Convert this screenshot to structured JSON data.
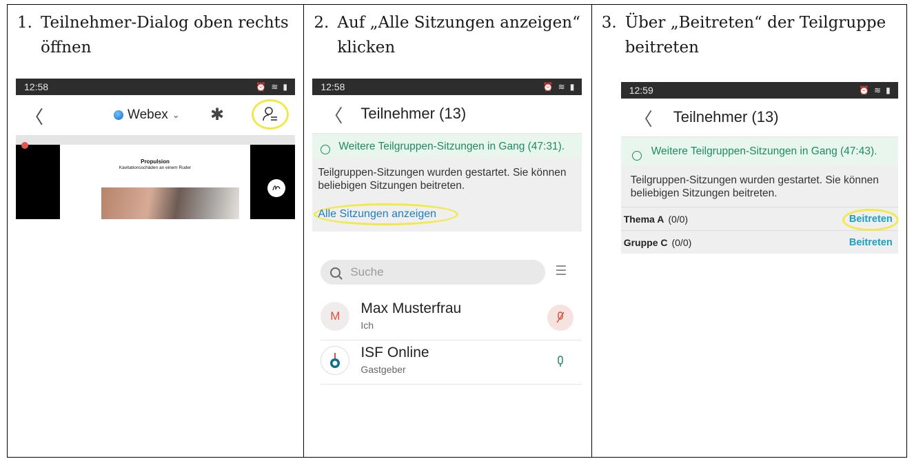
{
  "steps": [
    {
      "num": "1.",
      "text": "Teilnehmer-Dialog oben rechts öffnen"
    },
    {
      "num": "2.",
      "text": "Auf „Alle Sitzungen anzeigen“ klicken"
    },
    {
      "num": "3.",
      "text": "Über „Beitreten“ der Teilgruppe beitreten"
    }
  ],
  "panel1": {
    "time": "12:58",
    "app_name": "Webex",
    "chevron": "⌄",
    "back_icon": "〈",
    "bluetooth_icon": "✱",
    "slide_title": "Propulsion",
    "slide_subtitle": "Kavitationsschäden an einem Ruder"
  },
  "panel2": {
    "time": "12:58",
    "title": "Teilnehmer (13)",
    "banner": "Weitere Teilgruppen-Sitzungen in Gang (47:31).",
    "info": "Teilgruppen-Sitzungen wurden gestartet. Sie können beliebigen Sitzungen beitreten.",
    "link": "Alle Sitzungen anzeigen",
    "search_placeholder": "Suche",
    "participants": [
      {
        "initial": "M",
        "name": "Max Musterfrau",
        "role": "Ich",
        "mic": "muted"
      },
      {
        "initial": "",
        "name": "ISF Online",
        "role": "Gastgeber",
        "mic": "on"
      }
    ]
  },
  "panel3": {
    "time": "12:59",
    "title": "Teilnehmer (13)",
    "banner": "Weitere Teilgruppen-Sitzungen in Gang (47:43).",
    "info": "Teilgruppen-Sitzungen wurden gestartet. Sie können beliebigen Sitzungen beitreten.",
    "groups": [
      {
        "name": "Thema A",
        "count": "(0/0)",
        "join": "Beitreten"
      },
      {
        "name": "Gruppe C",
        "count": "(0/0)",
        "join": "Beitreten"
      }
    ]
  },
  "colors": {
    "highlight": "#f3e84a",
    "link": "#1d7cc1",
    "banner_text": "#1e8a63",
    "join": "#1aa0c2"
  },
  "icons": [
    "back-icon",
    "webex-shield-icon",
    "bluetooth-icon",
    "participants-icon",
    "clock-icon",
    "search-icon",
    "sort-icon",
    "mic-muted-icon",
    "mic-icon",
    "alarm-icon",
    "wifi-icon",
    "battery-icon"
  ]
}
